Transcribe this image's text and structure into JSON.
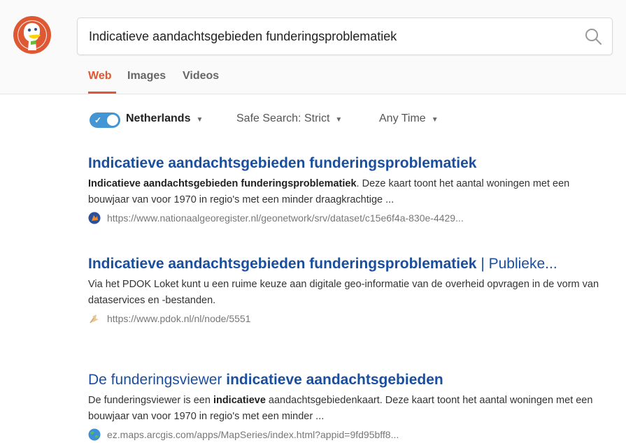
{
  "search": {
    "query": "Indicatieve aandachtsgebieden funderingsproblematiek",
    "logo": "duckduckgo-logo",
    "icon": "search-icon"
  },
  "tabs": [
    {
      "label": "Web",
      "active": true
    },
    {
      "label": "Images",
      "active": false
    },
    {
      "label": "Videos",
      "active": false
    }
  ],
  "filters": {
    "region_toggle_on": true,
    "region": "Netherlands",
    "safe_search": "Safe Search: Strict",
    "time": "Any Time"
  },
  "colors": {
    "accent": "#de5833",
    "link": "#1a4fa0",
    "toggle": "#4495d4"
  },
  "results": [
    {
      "title_bold": "Indicatieve aandachtsgebieden funderingsproblematiek",
      "title_rest": "",
      "snippet_bold": "Indicatieve aandachtsgebieden funderingsproblematiek",
      "snippet_rest": ". Deze kaart toont het aantal woningen met een bouwjaar van voor 1970 in regio's met een minder draagkrachtige ...",
      "url": "https://www.nationaalgeoregister.nl/geonetwork/srv/dataset/c15e6f4a-830e-4429...",
      "favicon": "ngr-favicon"
    },
    {
      "title_bold": "Indicatieve aandachtsgebieden funderingsproblematiek",
      "title_rest": " | Publieke...",
      "snippet": "Via het PDOK Loket kunt u een ruime keuze aan digitale geo-informatie van de overheid opvragen in de vorm van dataservices en -bestanden.",
      "url": "https://www.pdok.nl/nl/node/5551",
      "favicon": "pdok-favicon"
    },
    {
      "title_plain": "De funderingsviewer ",
      "title_bold": "indicatieve aandachtsgebieden",
      "snippet_pre": "De funderingsviewer is een ",
      "snippet_bold": "indicatieve",
      "snippet_post": " aandachtsgebiedenkaart. Deze kaart toont het aantal woningen met een bouwjaar van voor 1970 in regio's met een minder ...",
      "url": "ez.maps.arcgis.com/apps/MapSeries/index.html?appid=9fd95bff8...",
      "favicon": "globe-favicon"
    }
  ]
}
